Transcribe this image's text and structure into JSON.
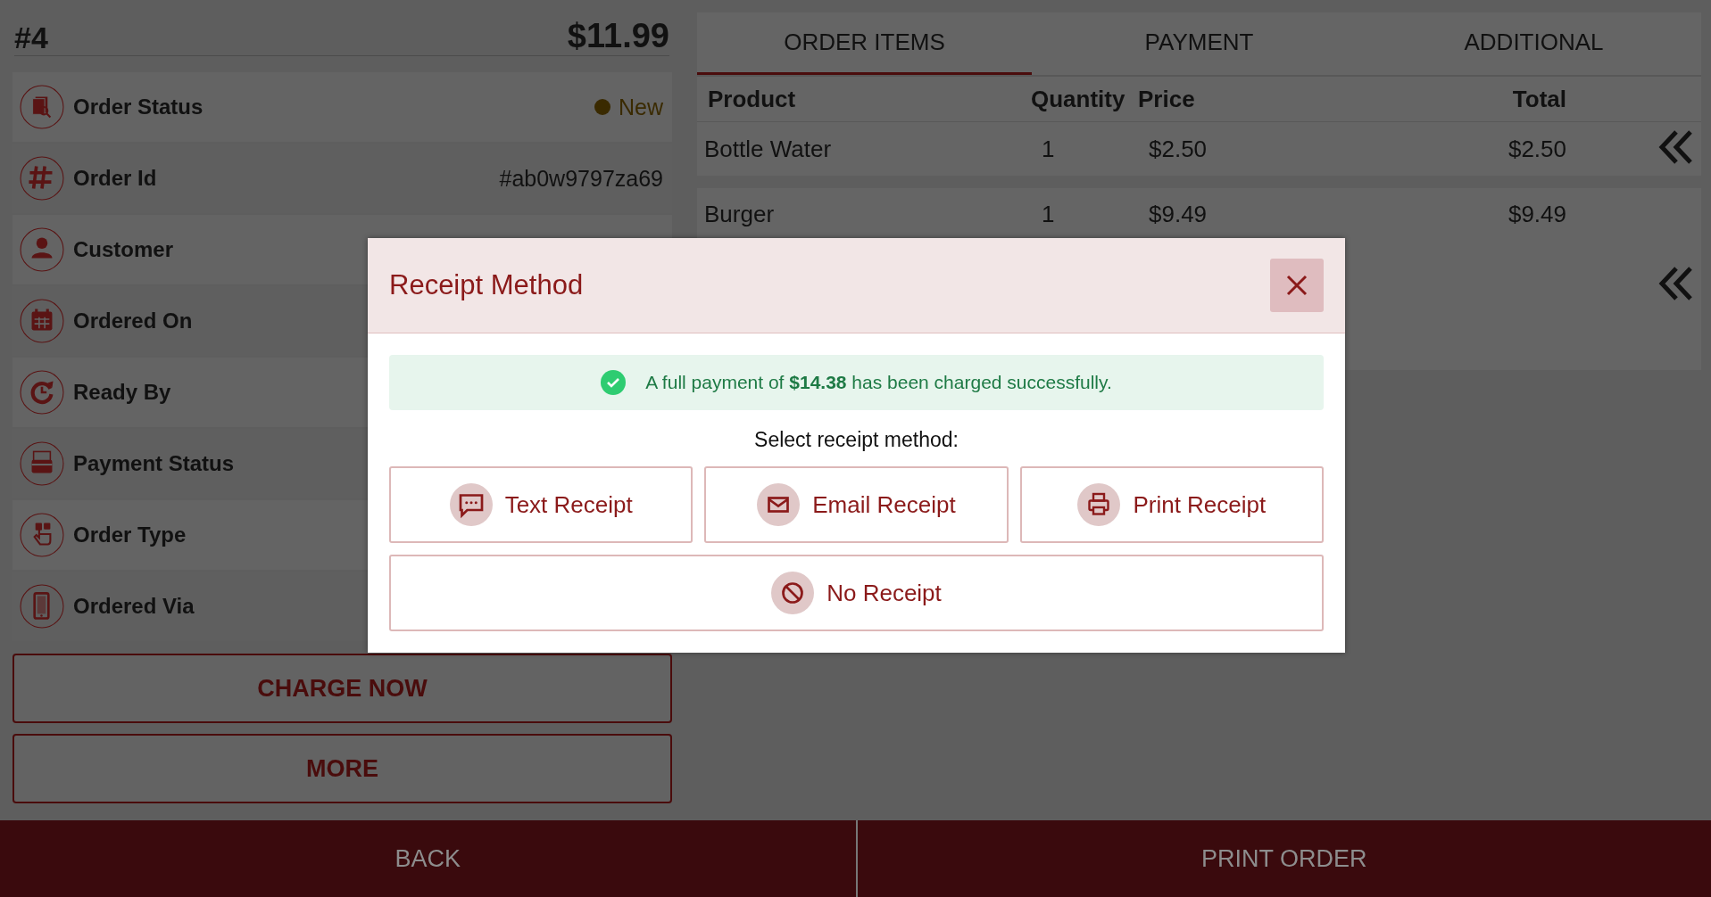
{
  "order": {
    "number": "#4",
    "total": "$11.99"
  },
  "info_rows": [
    {
      "label": "Order Status",
      "status": {
        "text": "New",
        "color": "#3a2a00"
      }
    },
    {
      "label": "Order Id",
      "value": "#ab0w9797za69"
    },
    {
      "label": "Customer"
    },
    {
      "label": "Ordered On"
    },
    {
      "label": "Ready By"
    },
    {
      "label": "Payment Status"
    },
    {
      "label": "Order Type"
    },
    {
      "label": "Ordered Via"
    }
  ],
  "actions": [
    "CHARGE NOW",
    "MORE"
  ],
  "tabs": [
    {
      "label": "ORDER ITEMS",
      "selected": true
    },
    {
      "label": "PAYMENT",
      "selected": false
    },
    {
      "label": "ADDITIONAL",
      "selected": false
    }
  ],
  "table": {
    "columns": [
      "Product",
      "Quantity",
      "Price",
      "Total"
    ],
    "rows": [
      [
        "Bottle Water",
        "1",
        "$2.50",
        "$2.50"
      ],
      [
        "Burger",
        "1",
        "$9.49",
        "$9.49"
      ]
    ]
  },
  "bottom_bar": [
    "BACK",
    "PRINT ORDER"
  ],
  "modal": {
    "title": "Receipt Method",
    "alert": "A full payment of **$14.38** has been charged successfully.",
    "prompt": "Select receipt method:",
    "options": [
      {
        "kind": "text",
        "label": "Text Receipt"
      },
      {
        "kind": "email",
        "label": "Email Receipt"
      },
      {
        "kind": "print",
        "label": "Print Receipt"
      },
      {
        "kind": "none",
        "label": "No Receipt"
      }
    ]
  }
}
